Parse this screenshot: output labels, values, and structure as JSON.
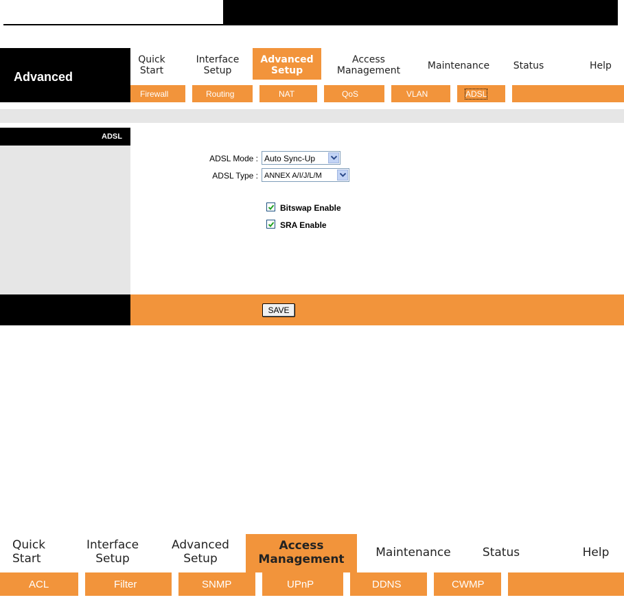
{
  "colors": {
    "accent": "#f2943b",
    "dark": "#000000",
    "panel_gray": "#e6e6e6"
  },
  "section_title": "Advanced",
  "nav": {
    "items": [
      {
        "line1": "Quick",
        "line2": "Start"
      },
      {
        "line1": "Interface",
        "line2": "Setup"
      },
      {
        "line1": "Advanced",
        "line2": "Setup"
      },
      {
        "line1": "Access",
        "line2": "Management"
      },
      {
        "line1": "Maintenance",
        "line2": ""
      },
      {
        "line1": "Status",
        "line2": ""
      },
      {
        "line1": "Help",
        "line2": ""
      }
    ],
    "active": "Advanced Setup",
    "sub_items": [
      "Firewall",
      "Routing",
      "NAT",
      "QoS",
      "VLAN",
      "ADSL"
    ],
    "sub_active": "ADSL"
  },
  "sidebar": {
    "label": "ADSL"
  },
  "form": {
    "mode_label": "ADSL Mode :",
    "mode_value": "Auto Sync-Up",
    "type_label": "ADSL Type :",
    "type_value": "ANNEX A/I/J/L/M",
    "bitswap_label": "Bitswap Enable",
    "bitswap_checked": true,
    "sra_label": "SRA Enable",
    "sra_checked": true,
    "save_label": "SAVE"
  },
  "nav2": {
    "items": [
      {
        "line1": "Quick",
        "line2": "Start"
      },
      {
        "line1": "Interface",
        "line2": "Setup"
      },
      {
        "line1": "Advanced",
        "line2": "Setup"
      },
      {
        "line1": "Access",
        "line2": "Management"
      },
      {
        "line1": "Maintenance",
        "line2": ""
      },
      {
        "line1": "Status",
        "line2": ""
      },
      {
        "line1": "Help",
        "line2": ""
      }
    ],
    "active": "Access Management",
    "sub_items": [
      "ACL",
      "Filter",
      "SNMP",
      "UPnP",
      "DDNS",
      "CWMP"
    ]
  }
}
